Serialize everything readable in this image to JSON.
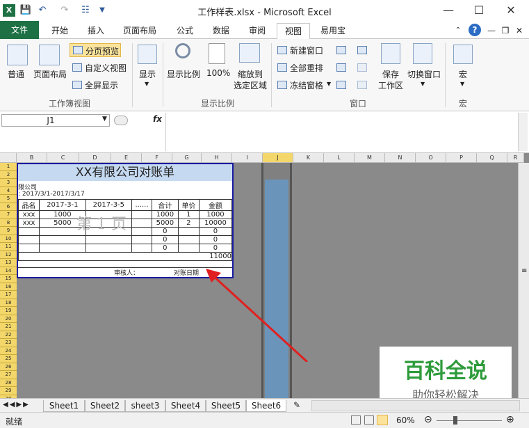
{
  "window": {
    "title": "工作样表.xlsx - Microsoft Excel"
  },
  "quick_access": [
    "excel-logo-icon",
    "save-icon",
    "undo-icon",
    "redo-icon",
    "tree-icon"
  ],
  "tabs": [
    {
      "label": "文件"
    },
    {
      "label": "开始"
    },
    {
      "label": "插入"
    },
    {
      "label": "页面布局"
    },
    {
      "label": "公式"
    },
    {
      "label": "数据"
    },
    {
      "label": "审阅"
    },
    {
      "label": "视图"
    },
    {
      "label": "易用宝"
    }
  ],
  "ribbon": {
    "workbook_views": {
      "label": "工作簿视图",
      "normal": "普通",
      "page_layout": "页面布局",
      "page_break": "分页预览",
      "custom_views": "自定义视图",
      "full_screen": "全屏显示"
    },
    "show": {
      "label": "显示"
    },
    "zoom": {
      "label": "显示比例",
      "zoom": "显示比例",
      "hundred": "100%",
      "zoom_to_selection": "缩放到",
      "zoom_to_selection2": "选定区域"
    },
    "window": {
      "label": "窗口",
      "new_window": "新建窗口",
      "arrange_all": "全部重排",
      "freeze_panes": "冻结窗格",
      "save_workspace": "保存",
      "save_workspace2": "工作区",
      "switch_windows": "切换窗口"
    },
    "macros": {
      "label": "宏",
      "button": "宏"
    }
  },
  "formula_bar": {
    "name_box": "J1",
    "fx": "fx",
    "formula": ""
  },
  "columns": [
    "B",
    "C",
    "D",
    "E",
    "F",
    "G",
    "H",
    "I",
    "J",
    "K",
    "L",
    "M",
    "N",
    "O",
    "P",
    "Q",
    "R"
  ],
  "rows": [
    "1",
    "2",
    "3",
    "4",
    "5",
    "6",
    "7",
    "8",
    "9",
    "10",
    "11",
    "12",
    "13",
    "14",
    "15",
    "16",
    "17",
    "18",
    "19",
    "20",
    "21",
    "22",
    "23",
    "24",
    "25",
    "26",
    "27",
    "28",
    "29",
    "30"
  ],
  "statement": {
    "title": "XX有限公司对账单",
    "company": "限公司",
    "period": ": 2017/3/1-2017/3/17",
    "headers": [
      "品名",
      "2017-3-1",
      "2017-3-5",
      "......",
      "合计",
      "单价",
      "金额"
    ],
    "rows": [
      [
        "xxx",
        "1000",
        "",
        "",
        "1000",
        "1",
        "1000"
      ],
      [
        "xxx",
        "5000",
        "",
        "",
        "5000",
        "2",
        "10000"
      ],
      [
        "",
        "",
        "",
        "",
        "0",
        "",
        "0"
      ],
      [
        "",
        "",
        "",
        "",
        "0",
        "",
        "0"
      ],
      [
        "",
        "",
        "",
        "",
        "0",
        "",
        "0"
      ]
    ],
    "total": "11000",
    "reviewer": "审核人：",
    "check_date": "对账日期",
    "watermark": "第 1 页"
  },
  "sheet_tabs": [
    "Sheet1",
    "Sheet2",
    "sheet3",
    "Sheet4",
    "Sheet5",
    "Sheet6"
  ],
  "active_sheet": "Sheet6",
  "status": {
    "ready": "就绪",
    "zoom": "60%"
  },
  "watermark": {
    "main": "百科全说",
    "sub": "助你轻松解决"
  },
  "colors": {
    "excel_green": "#1e7145",
    "highlight": "#f3d76a",
    "arrow": "#e02020"
  }
}
